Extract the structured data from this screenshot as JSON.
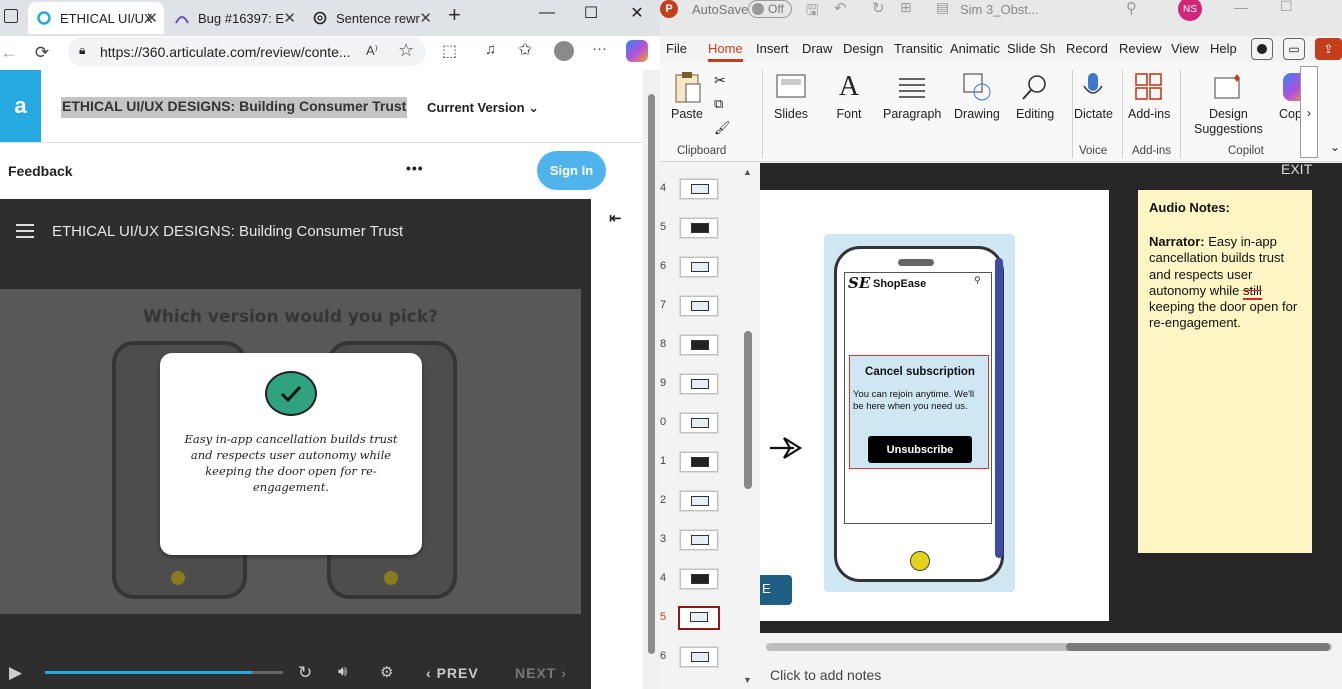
{
  "browser": {
    "tabs": [
      {
        "label": "ETHICAL UI/UX",
        "active": true
      },
      {
        "label": "Bug #16397: E",
        "active": false
      },
      {
        "label": "Sentence rewr",
        "active": false
      }
    ],
    "new_tab": "+",
    "url": "https://360.articulate.com/review/conte...",
    "window": {
      "minimize": "—",
      "maximize": "☐",
      "close": "✕"
    }
  },
  "articulate": {
    "logo": "a",
    "title": "ETHICAL UI/UX DESIGNS: Building Consumer Trust",
    "version_label": "Current Version",
    "feedback_label": "Feedback",
    "more_label": "•••",
    "signin_label": "Sign In"
  },
  "player": {
    "course_title": "ETHICAL UI/UX DESIGNS: Building Consumer Trust",
    "stage_question": "Which version would you pick?",
    "modal_text": "Easy in-app cancellation builds trust and respects user autonomy while keeping the door open for re-engagement.",
    "progress": 0.87,
    "prev_label": "PREV",
    "next_label": "NEXT",
    "accent": "#29a8e0",
    "check_color": "#2fa37f"
  },
  "ppt": {
    "autosave_label": "AutoSave",
    "autosave_state": "Off",
    "doc_title": "Sim 3_Obst...",
    "user_initials": "NS",
    "menu": [
      "File",
      "Home",
      "Insert",
      "Draw",
      "Design",
      "Transitic",
      "Animatic",
      "Slide Sh",
      "Record",
      "Review",
      "View",
      "Help"
    ],
    "active_menu": "Home",
    "ribbon": {
      "paste": "Paste",
      "slides": "Slides",
      "font": "Font",
      "paragraph": "Paragraph",
      "drawing": "Drawing",
      "editing": "Editing",
      "dictate": "Dictate",
      "addins": "Add-ins",
      "design_suggestions_1": "Design",
      "design_suggestions_2": "Suggestions",
      "copilot": "Copilo",
      "groups": {
        "clipboard": "Clipboard",
        "voice": "Voice",
        "addins": "Add-ins",
        "copilot": "Copilot"
      }
    },
    "thumb_numbers": [
      "4",
      "5",
      "6",
      "7",
      "8",
      "9",
      "0",
      "1",
      "2",
      "3",
      "4",
      "5",
      "6"
    ],
    "selected_thumb_index": 11,
    "slide": {
      "brand_logo": "SE",
      "brand_name": "ShopEase",
      "cancel_title": "Cancel subscription",
      "cancel_body": "You can rejoin anytime. We'll be here when you need us.",
      "unsubscribe_label": "Unsubscribe",
      "nav_tab_label": "E",
      "exit_label": "EXIT"
    },
    "notes": {
      "heading": "Audio Notes:",
      "narrator_label": "Narrator:",
      "text_before": " Easy in-app cancellation builds trust and respects user autonomy while ",
      "struck_word": "still",
      "text_after": " keeping the door open for re-engagement."
    },
    "notes_placeholder": "Click to add notes",
    "brand_color": "#c43e1c",
    "notes_bg": "#fdf6c4"
  }
}
